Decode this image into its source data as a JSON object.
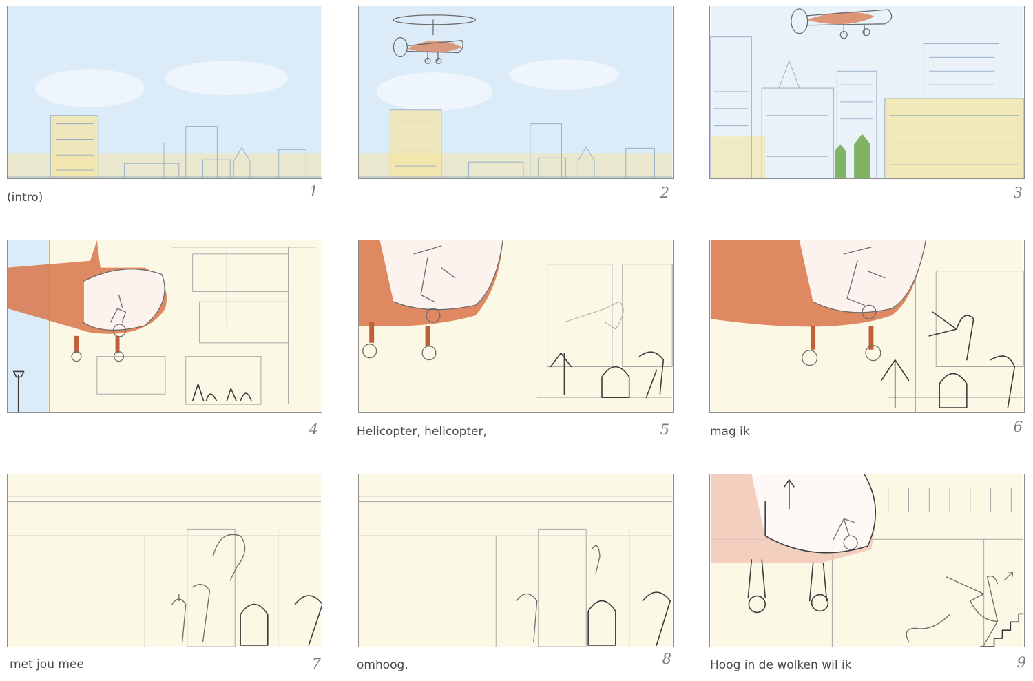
{
  "storyboard": {
    "panels": [
      {
        "number": "1",
        "caption": "(intro)"
      },
      {
        "number": "2",
        "caption": ""
      },
      {
        "number": "3",
        "caption": ""
      },
      {
        "number": "4",
        "caption": ""
      },
      {
        "number": "5",
        "caption": "Helicopter, helicopter,"
      },
      {
        "number": "6",
        "caption": "mag ik"
      },
      {
        "number": "7",
        "caption": "met jou mee"
      },
      {
        "number": "8",
        "caption": "omhoog."
      },
      {
        "number": "9",
        "caption": "Hoog in de wolken wil ik"
      }
    ]
  },
  "colors": {
    "sky": "#dcebf8",
    "cream": "#fcf8e6",
    "helicopter": "#d9764a",
    "building_yellow": "#f5e6a3",
    "tree_green": "#6fa84a"
  }
}
